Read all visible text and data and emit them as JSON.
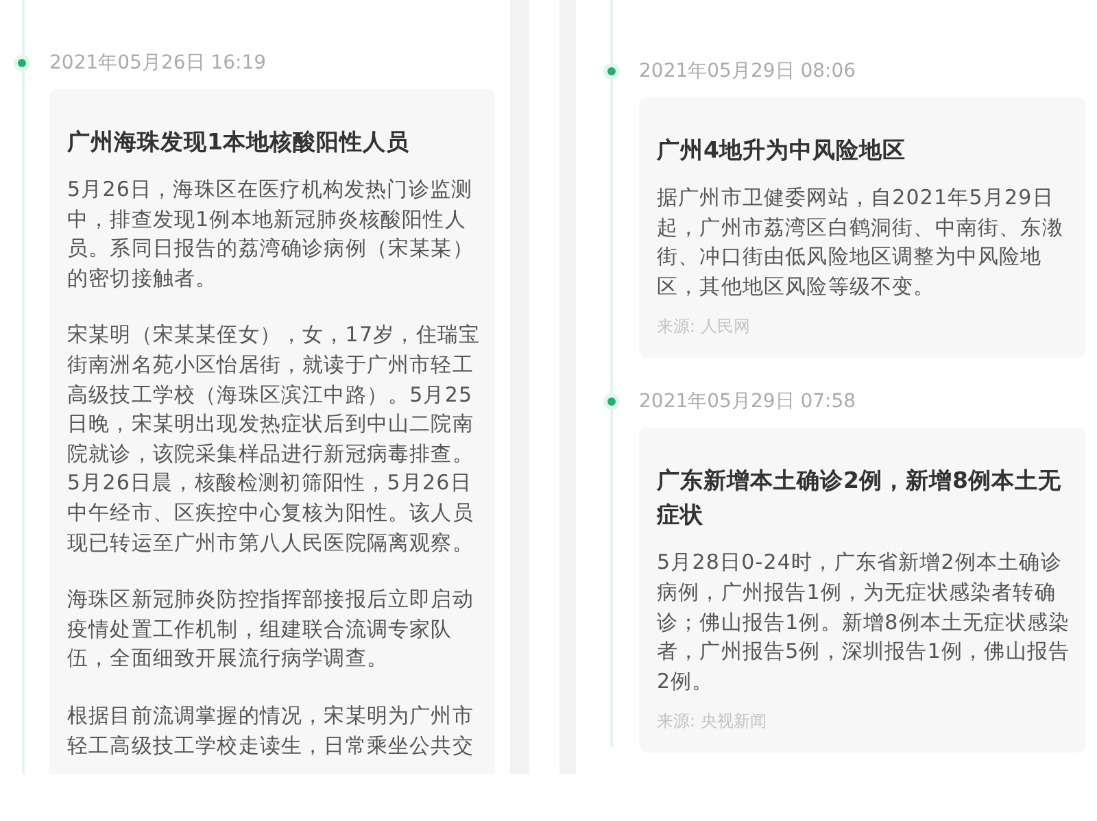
{
  "panels": [
    {
      "entries": [
        {
          "time": "2021年05月26日 16:19",
          "title": "广州海珠发现1本地核酸阳性人员",
          "paragraphs": [
            "5月26日，海珠区在医疗机构发热门诊监测中，排查发现1例本地新冠肺炎核酸阳性人员。系同日报告的荔湾确诊病例（宋某某）的密切接触者。",
            "宋某明（宋某某侄女），女，17岁，住瑞宝街南洲名苑小区怡居街，就读于广州市轻工高级技工学校（海珠区滨江中路）。5月25日晚，宋某明出现发热症状后到中山二院南院就诊，该院采集样品进行新冠病毒排查。5月26日晨，核酸检测初筛阳性，5月26日中午经市、区疾控中心复核为阳性。该人员现已转运至广州市第八人民医院隔离观察。",
            "海珠区新冠肺炎防控指挥部接报后立即启动疫情处置工作机制，组建联合流调专家队伍，全面细致开展流行病学调查。",
            "根据目前流调掌握的情况，宋某明为广州市轻工高级技工学校走读生，日常乘坐公共交"
          ]
        }
      ]
    },
    {
      "entries": [
        {
          "time": "2021年05月29日 08:06",
          "title": "广州4地升为中风险地区",
          "paragraphs": [
            "据广州市卫健委网站，自2021年5月29日起，广州市荔湾区白鹤洞街、中南街、东漖街、冲口街由低风险地区调整为中风险地区，其他地区风险等级不变。"
          ],
          "source": "来源: 人民网"
        },
        {
          "time": "2021年05月29日 07:58",
          "title": "广东新增本土确诊2例，新增8例本土无症状",
          "paragraphs": [
            "5月28日0-24时，广东省新增2例本土确诊病例，广州报告1例，为无症状感染者转确诊；佛山报告1例。新增8例本土无症状感染者，广州报告5例，深圳报告1例，佛山报告2例。"
          ],
          "source": "来源: 央视新闻"
        }
      ]
    }
  ]
}
